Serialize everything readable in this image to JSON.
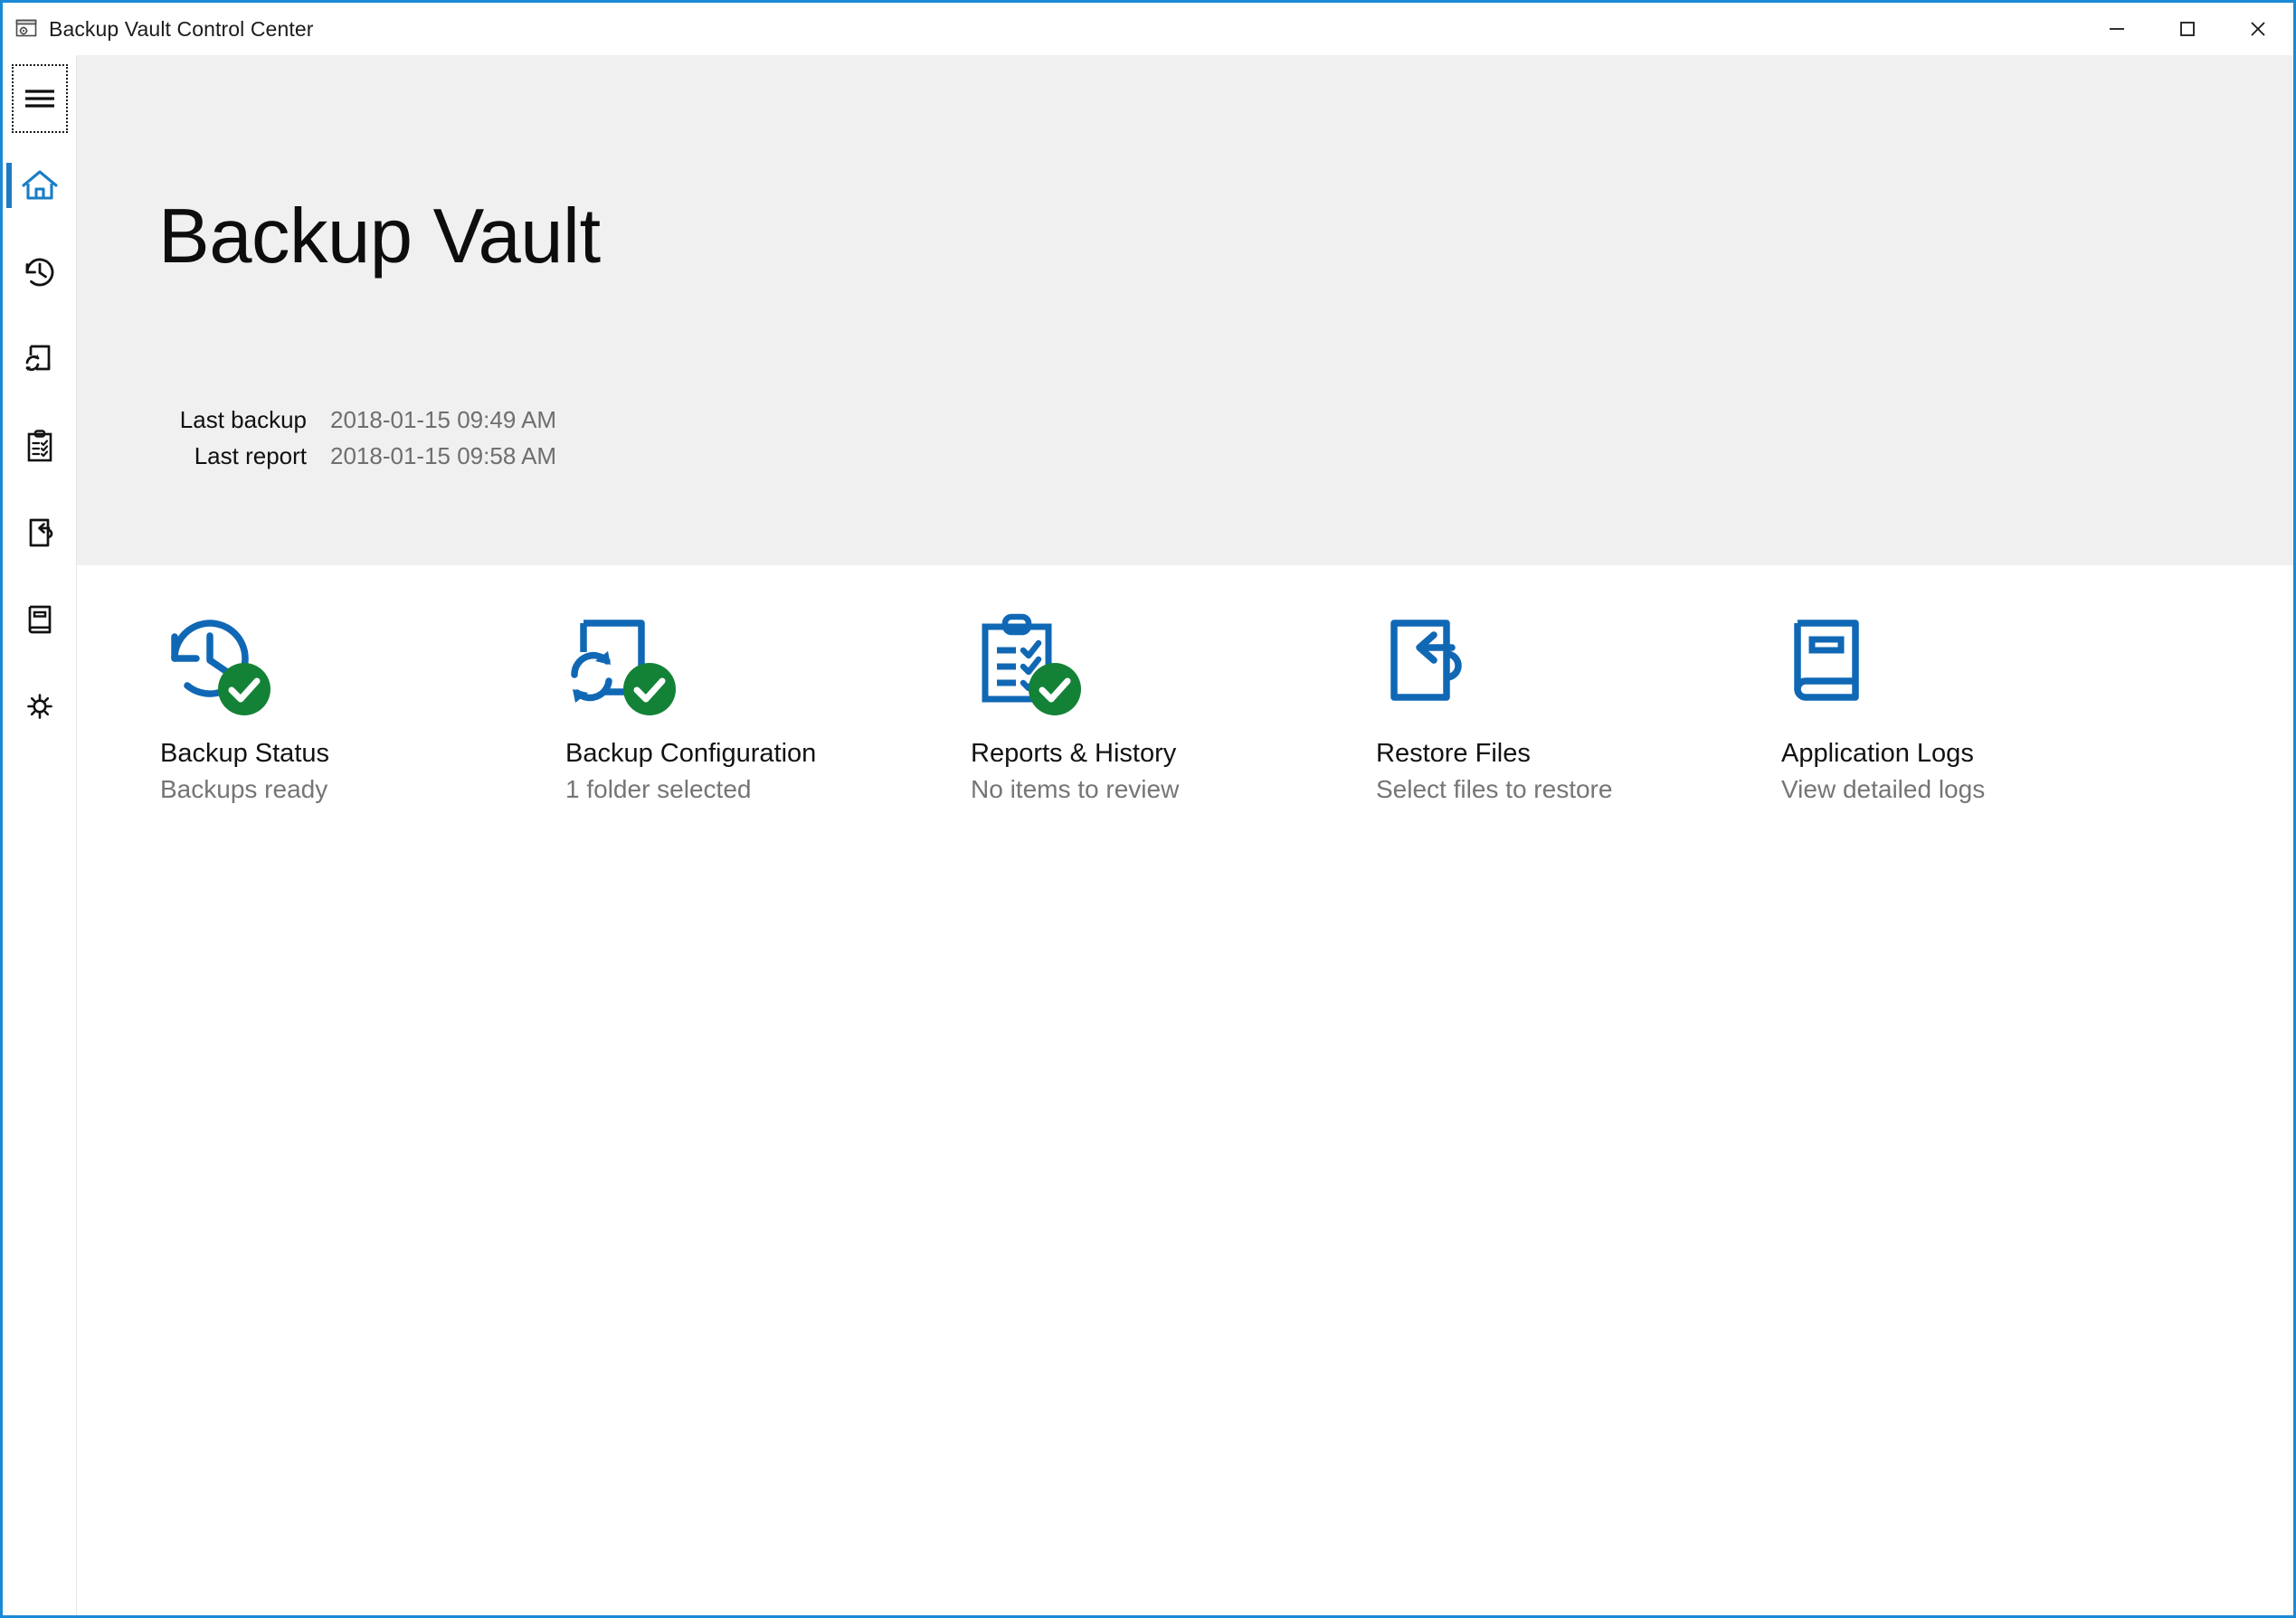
{
  "window": {
    "title": "Backup Vault Control Center",
    "app_icon": "app-window-gear-icon",
    "accent_color": "#1a8ad4",
    "controls": {
      "minimize": "minimize-icon",
      "maximize": "maximize-icon",
      "close": "close-icon"
    }
  },
  "sidebar": {
    "items": [
      {
        "name": "hamburger",
        "icon": "hamburger-menu-icon",
        "active": false,
        "focused": true
      },
      {
        "name": "home",
        "icon": "home-icon",
        "active": true,
        "focused": false
      },
      {
        "name": "backup-status",
        "icon": "history-clock-icon",
        "active": false,
        "focused": false
      },
      {
        "name": "backup-configuration",
        "icon": "page-sync-icon",
        "active": false,
        "focused": false
      },
      {
        "name": "reports-history",
        "icon": "clipboard-checklist-icon",
        "active": false,
        "focused": false
      },
      {
        "name": "restore-files",
        "icon": "page-restore-arrow-icon",
        "active": false,
        "focused": false
      },
      {
        "name": "application-logs",
        "icon": "book-icon",
        "active": false,
        "focused": false
      },
      {
        "name": "settings",
        "icon": "gear-icon",
        "active": false,
        "focused": false
      }
    ]
  },
  "hero": {
    "title": "Backup Vault",
    "background_color": "#f0f0f0",
    "meta": [
      {
        "label": "Last backup",
        "value": "2018-01-15 09:49 AM"
      },
      {
        "label": "Last report",
        "value": "2018-01-15 09:58 AM"
      }
    ]
  },
  "tiles": [
    {
      "title": "Backup Status",
      "subtitle": "Backups ready",
      "icon": "history-clock-icon",
      "badge": "green-check-badge",
      "has_badge": true
    },
    {
      "title": "Backup Configuration",
      "subtitle": "1 folder selected",
      "icon": "page-sync-icon",
      "badge": "green-check-badge",
      "has_badge": true
    },
    {
      "title": "Reports & History",
      "subtitle": "No items to review",
      "icon": "clipboard-checklist-icon",
      "badge": "green-check-badge",
      "has_badge": true
    },
    {
      "title": "Restore Files",
      "subtitle": "Select files to restore",
      "icon": "page-restore-arrow-icon",
      "badge": null,
      "has_badge": false
    },
    {
      "title": "Application Logs",
      "subtitle": "View detailed logs",
      "icon": "book-icon",
      "badge": null,
      "has_badge": false
    }
  ],
  "colors": {
    "icon_blue": "#1068b5",
    "check_green": "#138237",
    "text_primary": "#121212",
    "text_secondary": "#757575"
  }
}
